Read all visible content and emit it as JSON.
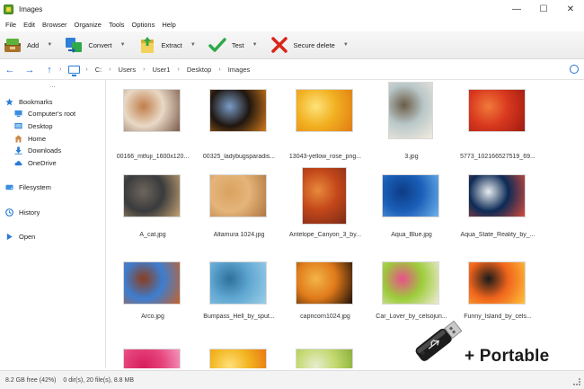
{
  "window": {
    "title": "Images",
    "minimize": "—",
    "maximize": "☐",
    "close": "✕"
  },
  "menu": [
    "File",
    "Edit",
    "Browser",
    "Organize",
    "Tools",
    "Options",
    "Help"
  ],
  "toolbar": [
    {
      "label": "Add",
      "icon": "add-archive-icon"
    },
    {
      "label": "Convert",
      "icon": "convert-icon"
    },
    {
      "label": "Extract",
      "icon": "extract-icon"
    },
    {
      "label": "Test",
      "icon": "test-check-icon"
    },
    {
      "label": "Secure delete",
      "icon": "secure-delete-icon"
    }
  ],
  "address": {
    "back": "←",
    "forward": "→",
    "up": "↑",
    "crumbs": [
      "C:",
      "Users",
      "User1",
      "Desktop",
      "Images"
    ]
  },
  "sidebar": {
    "dots": "...",
    "bookmarks_label": "Bookmarks",
    "bookmarks": [
      "Computer's root",
      "Desktop",
      "Home",
      "Downloads",
      "OneDrive"
    ],
    "filesystem_label": "Filesystem",
    "history_label": "History",
    "open_label": "Open"
  },
  "files": [
    {
      "name": "00166_mtfuji_1600x120...",
      "palette": [
        "#e9d9c6",
        "#7b5a4a",
        "#c07e4a"
      ]
    },
    {
      "name": "00325_ladybugsparadis...",
      "palette": [
        "#1f1610",
        "#d47b1a",
        "#7a9cc8"
      ]
    },
    {
      "name": "13043-yellow_rose_png...",
      "palette": [
        "#f2b021",
        "#e07b14",
        "#fde37a"
      ]
    },
    {
      "name": "3.jpg",
      "palette": [
        "#b9c7c8",
        "#f2ece0",
        "#6b5c48"
      ]
    },
    {
      "name": "5773_102166527519_69...",
      "palette": [
        "#d8381e",
        "#9e1b10",
        "#f07a3a"
      ]
    },
    {
      "name": "A_cat.jpg",
      "palette": [
        "#3a3b3d",
        "#c4a272",
        "#6d655c"
      ]
    },
    {
      "name": "Altamura 1024.jpg",
      "palette": [
        "#e4b47a",
        "#b07641",
        "#d9a360"
      ]
    },
    {
      "name": "Antelope_Canyon_3_by...",
      "palette": [
        "#c4481a",
        "#7c2a17",
        "#e88a3c"
      ]
    },
    {
      "name": "Aqua_Blue.jpg",
      "palette": [
        "#1a5fb8",
        "#6eb2ea",
        "#0d3c86"
      ]
    },
    {
      "name": "Aqua_State_Reality_by_...",
      "palette": [
        "#0c2a55",
        "#d84a3c",
        "#e8ecf0"
      ]
    },
    {
      "name": "Arco.jpg",
      "palette": [
        "#3d7ed0",
        "#c5622c",
        "#8b3d1e"
      ]
    },
    {
      "name": "Bumpass_Hell_by_sput...",
      "palette": [
        "#5fa7d2",
        "#9ccde6",
        "#2f6f9c"
      ]
    },
    {
      "name": "capricorn1024.jpg",
      "palette": [
        "#e07a1a",
        "#1f1208",
        "#f3b548"
      ]
    },
    {
      "name": "Car_Lover_by_celsojun...",
      "palette": [
        "#9ccc3a",
        "#f0ead6",
        "#e8508a"
      ]
    },
    {
      "name": "Funny_Island_by_cels...",
      "palette": [
        "#f0641c",
        "#ffc23a",
        "#1a1a1a"
      ]
    },
    {
      "name": "",
      "palette": [
        "#e6447c",
        "#f6a6c8",
        "#d81f5e"
      ]
    },
    {
      "name": "",
      "palette": [
        "#f2b41e",
        "#e76b14",
        "#ffe07a"
      ]
    },
    {
      "name": "",
      "palette": [
        "#c3d96e",
        "#7fa832",
        "#e8ecd0"
      ]
    }
  ],
  "status": {
    "free": "8.2 GB free (42%)",
    "counts": "0 dir(s), 20 file(s), 8.8 MB"
  },
  "badge": {
    "text": "+ Portable"
  }
}
